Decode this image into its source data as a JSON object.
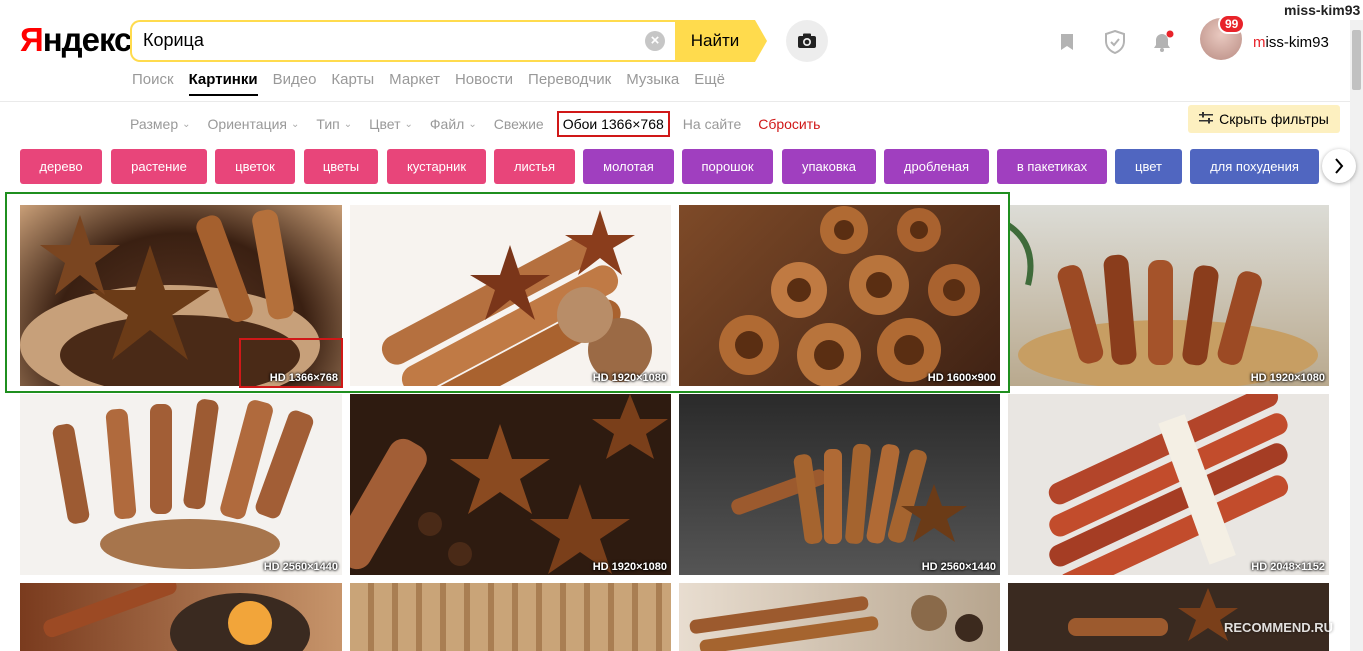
{
  "header": {
    "logo": "Яндекс",
    "search_value": "Корица",
    "find_label": "Найти",
    "user_name": "miss-kim93",
    "badge_count": "99",
    "corner_user": "miss-kim93"
  },
  "nav": {
    "items": [
      "Поиск",
      "Картинки",
      "Видео",
      "Карты",
      "Маркет",
      "Новости",
      "Переводчик",
      "Музыка",
      "Ещё"
    ],
    "active": "Картинки"
  },
  "filters": {
    "size": "Размер",
    "orientation": "Ориентация",
    "type": "Тип",
    "color": "Цвет",
    "file": "Файл",
    "fresh": "Свежие",
    "selected": "Обои 1366×768",
    "on_site": "На сайте",
    "reset": "Сбросить",
    "hide_filters": "Скрыть фильтры"
  },
  "tags": [
    {
      "label": "дерево",
      "color": "#e8457a"
    },
    {
      "label": "растение",
      "color": "#e8457a"
    },
    {
      "label": "цветок",
      "color": "#e8457a"
    },
    {
      "label": "цветы",
      "color": "#e8457a"
    },
    {
      "label": "кустарник",
      "color": "#e8457a"
    },
    {
      "label": "листья",
      "color": "#e8457a"
    },
    {
      "label": "молотая",
      "color": "#a03fbf"
    },
    {
      "label": "порошок",
      "color": "#a03fbf"
    },
    {
      "label": "упаковка",
      "color": "#a03fbf"
    },
    {
      "label": "дробленая",
      "color": "#a03fbf"
    },
    {
      "label": "в пакетиках",
      "color": "#a03fbf"
    },
    {
      "label": "цвет",
      "color": "#5066c0"
    },
    {
      "label": "для похудения",
      "color": "#5066c0"
    }
  ],
  "images": [
    {
      "res": "HD 1366×768"
    },
    {
      "res": "HD 1920×1080"
    },
    {
      "res": "HD 1600×900"
    },
    {
      "res": "HD 1920×1080"
    },
    {
      "res": "HD 2560×1440"
    },
    {
      "res": "HD 1920×1080"
    },
    {
      "res": "HD 2560×1440"
    },
    {
      "res": "HD 2048×1152"
    },
    {
      "res": ""
    },
    {
      "res": ""
    },
    {
      "res": ""
    },
    {
      "res": ""
    }
  ],
  "watermark": "RECOMMEND.RU",
  "colors": {
    "accent_yellow": "#ffdb4d",
    "highlight_red": "#d01818",
    "highlight_green": "#1f8f1f"
  }
}
